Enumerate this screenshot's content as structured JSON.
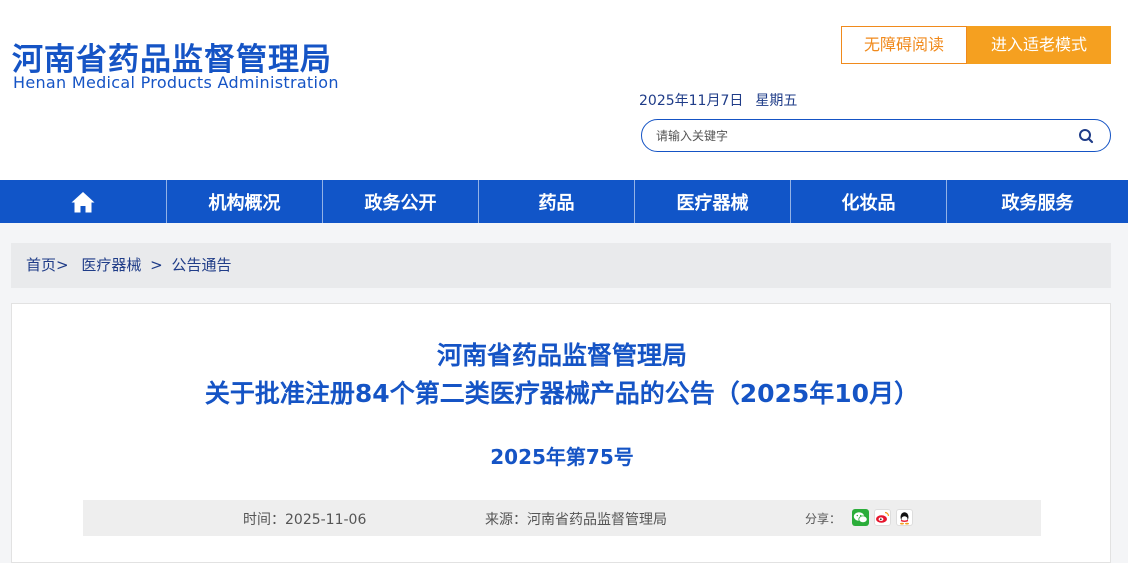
{
  "header": {
    "title_cn": "河南省药品监督管理局",
    "title_en": "Henan Medical Products Administration",
    "accessibility_label": "无障碍阅读",
    "elder_mode_label": "进入适老模式",
    "date": "2025年11月7日",
    "weekday": "星期五",
    "search_placeholder": "请输入关键字"
  },
  "nav": {
    "items": [
      {
        "label": "",
        "icon": "home-icon"
      },
      {
        "label": "机构概况"
      },
      {
        "label": "政务公开"
      },
      {
        "label": "药品"
      },
      {
        "label": "医疗器械"
      },
      {
        "label": "化妆品"
      },
      {
        "label": "政务服务"
      }
    ]
  },
  "breadcrumb": {
    "items": [
      "首页",
      "医疗器械",
      "公告通告"
    ],
    "separators": [
      ">",
      ">"
    ]
  },
  "article": {
    "title_line1": "河南省药品监督管理局",
    "title_line2": "关于批准注册84个第二类医疗器械产品的公告（2025年10月）",
    "doc_number": "2025年第75号",
    "time_label": "时间：",
    "time_value": "2025-11-06",
    "source_label": "来源：",
    "source_value": "河南省药品监督管理局",
    "share_label": "分享："
  },
  "colors": {
    "brand_blue": "#1554c5",
    "nav_blue": "#1155c8",
    "accent_orange": "#f5a020"
  },
  "share_icons": [
    "wechat-icon",
    "weibo-icon",
    "qq-icon"
  ]
}
